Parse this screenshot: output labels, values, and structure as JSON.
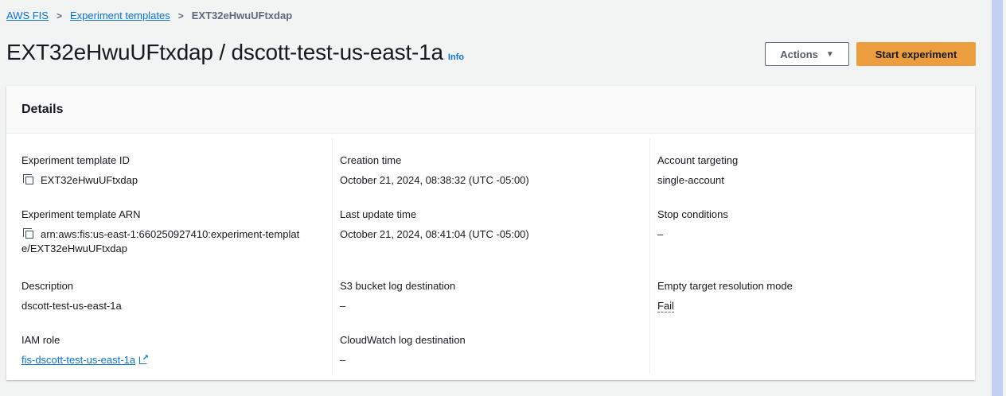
{
  "breadcrumb": {
    "items": [
      "AWS FIS",
      "Experiment templates"
    ],
    "current": "EXT32eHwuUFtxdap"
  },
  "header": {
    "title": "EXT32eHwuUFtxdap / dscott-test-us-east-1a",
    "info_label": "Info",
    "actions_label": "Actions",
    "start_label": "Start experiment"
  },
  "details": {
    "title": "Details",
    "template_id": {
      "label": "Experiment template ID",
      "value": "EXT32eHwuUFtxdap"
    },
    "template_arn": {
      "label": "Experiment template ARN",
      "value_line1": "arn:aws:fis:us-east-1:660250927410:experiment-templat",
      "value_line2": "e/EXT32eHwuUFtxdap"
    },
    "description": {
      "label": "Description",
      "value": "dscott-test-us-east-1a"
    },
    "iam_role": {
      "label": "IAM role",
      "value": "fis-dscott-test-us-east-1a"
    },
    "creation_time": {
      "label": "Creation time",
      "value": "October 21, 2024, 08:38:32 (UTC -05:00)"
    },
    "last_update_time": {
      "label": "Last update time",
      "value": "October 21, 2024, 08:41:04 (UTC -05:00)"
    },
    "s3_log": {
      "label": "S3 bucket log destination",
      "value": "–"
    },
    "cloudwatch_log": {
      "label": "CloudWatch log destination",
      "value": "–"
    },
    "account_targeting": {
      "label": "Account targeting",
      "value": "single-account"
    },
    "stop_conditions": {
      "label": "Stop conditions",
      "value": "–"
    },
    "empty_target": {
      "label": "Empty target resolution mode",
      "value": "Fail"
    }
  },
  "colors": {
    "link": "#0972d3",
    "primary_button": "#ec9e3e"
  }
}
